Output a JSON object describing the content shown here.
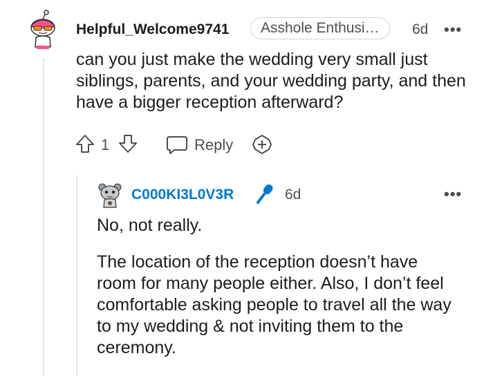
{
  "comment": {
    "username": "Helpful_Welcome9741",
    "flair": "Asshole Enthusi…",
    "time": "6d",
    "more": "•••",
    "body": "can you just make the wedding very small just siblings, parents, and your wedding party, and then have a bigger reception afterward?",
    "vote_count": "1",
    "reply_label": "Reply"
  },
  "reply": {
    "username": "C000KI3L0V3R",
    "time": "6d",
    "more": "•••",
    "paragraph1": "No, not really.",
    "paragraph2": "The location of the reception doesn’t have room for many people either. Also, I don’t feel comfortable asking people to travel all the way to my wedding & not inviting them to the ceremony."
  },
  "colors": {
    "op_accent": "#0079d3",
    "text": "#1c1c1c",
    "meta": "#4c4e50"
  }
}
